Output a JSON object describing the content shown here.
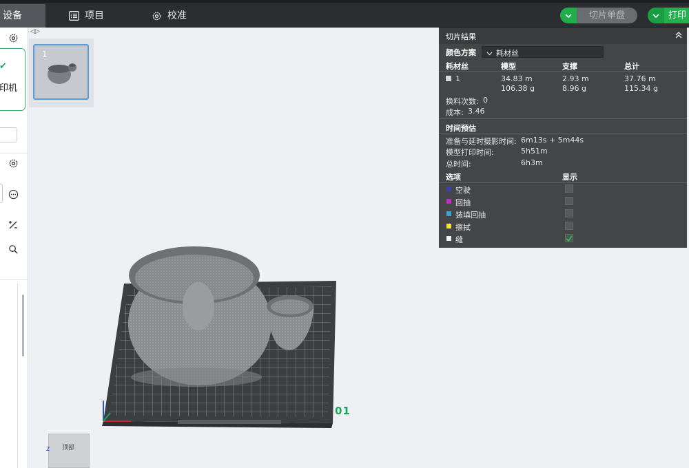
{
  "topbar": {
    "device_tab": "设备",
    "project_tab": "项目",
    "calibration_tab": "校准",
    "slice_button": "切片单盘",
    "print_button": "打印"
  },
  "sidebar": {
    "printer_label": "印机"
  },
  "plates": [
    {
      "number": "1"
    }
  ],
  "viewport": {
    "plate_label": "01",
    "view_cube_label": "顶部",
    "axis_z": "Z"
  },
  "slice_result": {
    "title": "切片结果",
    "color_scheme_label": "颜色方案",
    "color_scheme_value": "耗材丝",
    "table_headers": [
      "耗材丝",
      "模型",
      "支撑",
      "总计"
    ],
    "rows": [
      {
        "filament": "1",
        "model_length": "34.83 m",
        "model_weight": "106.38 g",
        "support_length": "2.93 m",
        "support_weight": "8.96 g",
        "total_length": "37.76 m",
        "total_weight": "115.34 g",
        "color": "#d9d9d9"
      }
    ],
    "filament_changes_label": "换料次数:",
    "filament_changes_value": "0",
    "cost_label": "成本:",
    "cost_value": "3.46",
    "time_estimate_title": "时间预估",
    "prep_time_label": "准备与延时摄影时间:",
    "prep_time_value": "6m13s + 5m44s",
    "model_print_time_label": "模型打印时间:",
    "model_print_time_value": "5h51m",
    "total_time_label": "总时间:",
    "total_time_value": "6h3m",
    "options_header": "选项",
    "display_header": "显示",
    "options": [
      {
        "name": "空驶",
        "color": "#3b3fb0",
        "checked": false
      },
      {
        "name": "回抽",
        "color": "#c02ac7",
        "checked": false
      },
      {
        "name": "装填回抽",
        "color": "#3aa6c9",
        "checked": false
      },
      {
        "name": "擦拭",
        "color": "#f2e81b",
        "checked": false
      },
      {
        "name": "缝",
        "color": "#f2f2f2",
        "checked": true
      }
    ]
  },
  "colors": {
    "accent_green": "#1fae4a",
    "panel_bg": "#434547",
    "selection_blue": "#5b9bd6"
  }
}
